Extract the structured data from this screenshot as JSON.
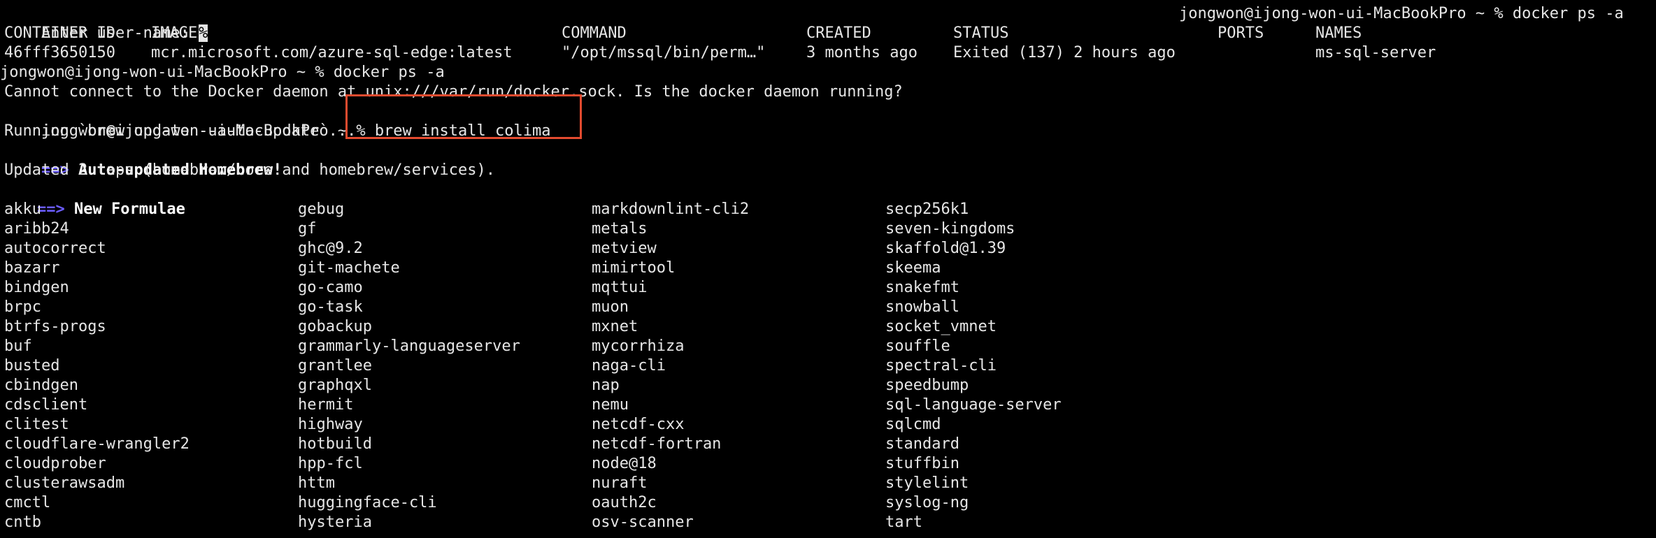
{
  "prompt_line": {
    "enter_user": "Enter user-name: ",
    "cursor_char": "%",
    "right_prompt": "jongwon@ijong-won-ui-MacBookPro ~ % docker ps -a"
  },
  "docker_table": {
    "headers": [
      "CONTAINER ID",
      "IMAGE",
      "COMMAND",
      "CREATED",
      "STATUS",
      "PORTS",
      "NAMES"
    ],
    "row": [
      "46fff3650150",
      "mcr.microsoft.com/azure-sql-edge:latest",
      "\"/opt/mssql/bin/perm…\"",
      "3 months ago",
      "Exited (137) 2 hours ago",
      "",
      "ms-sql-server"
    ]
  },
  "lines": {
    "prompt1": "jongwon@ijong-won-ui-MacBookPro ~ % docker ps -a",
    "error": "Cannot connect to the Docker daemon at unix:///var/run/docker.sock. Is the docker daemon running?",
    "prompt2_user": "jongwon@ijong-won-ui-MacBookPro ~ % ",
    "prompt2_cmd": "brew install colima",
    "running": "Running `brew update --auto-update`...",
    "auto_updated_arrow": "==>",
    "auto_updated_text": " Auto-updated Homebrew!",
    "updated_taps": "Updated 2 taps (homebrew/core and homebrew/services).",
    "new_formulae_arrow": "==>",
    "new_formulae_text": " New Formulae"
  },
  "formulae_columns": [
    [
      "akku",
      "aribb24",
      "autocorrect",
      "bazarr",
      "bindgen",
      "brpc",
      "btrfs-progs",
      "buf",
      "busted",
      "cbindgen",
      "cdsclient",
      "clitest",
      "cloudflare-wrangler2",
      "cloudprober",
      "clusterawsadm",
      "cmctl",
      "cntb"
    ],
    [
      "gebug",
      "gf",
      "ghc@9.2",
      "git-machete",
      "go-camo",
      "go-task",
      "gobackup",
      "grammarly-languageserver",
      "grantlee",
      "graphqxl",
      "hermit",
      "highway",
      "hotbuild",
      "hpp-fcl",
      "httm",
      "huggingface-cli",
      "hysteria"
    ],
    [
      "markdownlint-cli2",
      "metals",
      "metview",
      "mimirtool",
      "mqttui",
      "muon",
      "mxnet",
      "mycorrhiza",
      "naga-cli",
      "nap",
      "nemu",
      "netcdf-cxx",
      "netcdf-fortran",
      "node@18",
      "nuraft",
      "oauth2c",
      "osv-scanner"
    ],
    [
      "secp256k1",
      "seven-kingdoms",
      "skaffold@1.39",
      "skeema",
      "snakefmt",
      "snowball",
      "socket_vmnet",
      "souffle",
      "spectral-cli",
      "speedbump",
      "sql-language-server",
      "sqlcmd",
      "standard",
      "stuffbin",
      "stylelint",
      "syslog-ng",
      "tart"
    ]
  ],
  "colors": {
    "background": "#000000",
    "text": "#e6e6e6",
    "arrow": "#6a5cff",
    "highlight": "#e34b2f"
  }
}
